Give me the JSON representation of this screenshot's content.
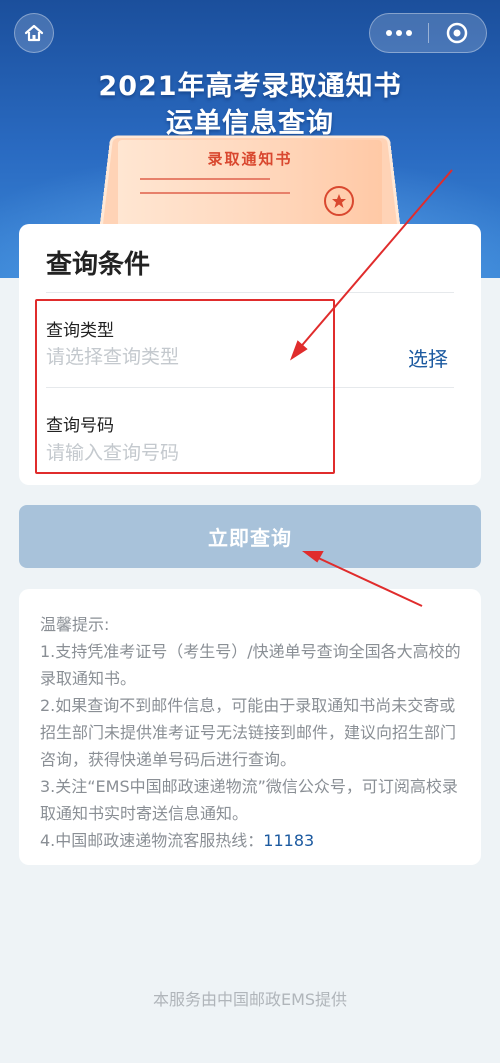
{
  "header": {
    "title_line1": "2021年高考录取通知书",
    "title_line2": "运单信息查询",
    "letter_heading": "录取通知书"
  },
  "query": {
    "section_title": "查询条件",
    "type_label": "查询类型",
    "type_placeholder": "请选择查询类型",
    "select_label": "选择",
    "number_label": "查询号码",
    "number_placeholder": "请输入查询号码"
  },
  "submit_label": "立即查询",
  "tips": {
    "heading": "温馨提示:",
    "item1": "1.支持凭准考证号（考生号）/快递单号查询全国各大高校的录取通知书。",
    "item2": "2.如果查询不到邮件信息，可能由于录取通知书尚未交寄或招生部门未提供准考证号无法链接到邮件，建议向招生部门咨询，获得快递单号码后进行查询。",
    "item3": "3.关注“EMS中国邮政速递物流”微信公众号，可订阅高校录取通知书实时寄送信息通知。",
    "item4_prefix": "4.中国邮政速递物流客服热线：",
    "item4_phone": "11183"
  },
  "footer": "本服务由中国邮政EMS提供",
  "colors": {
    "banner_blue": "#1b4f9c",
    "link_blue": "#1c5aa0",
    "button_disabled": "#a8c2da",
    "annotation_red": "#e02c2c"
  },
  "icons": {
    "home": "home-icon",
    "more": "more-dots-icon",
    "close": "close-circle-icon"
  }
}
